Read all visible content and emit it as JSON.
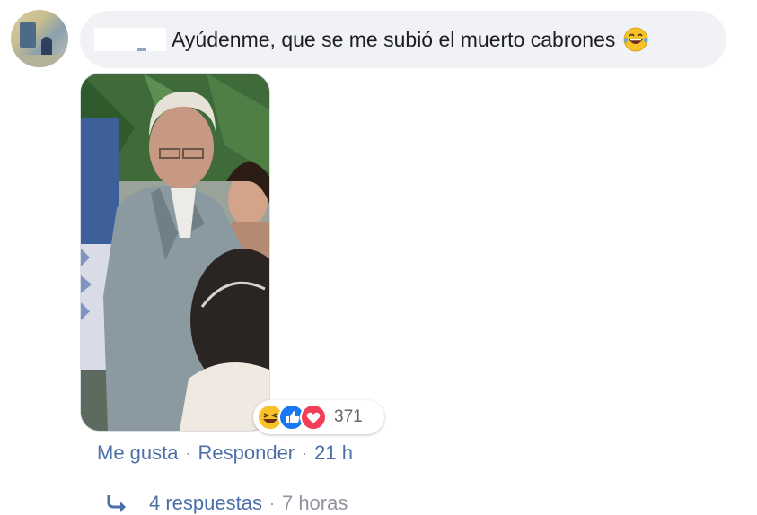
{
  "comment": {
    "text": "Ayúdenme, que se me subió el muerto cabrones",
    "emoji_icon": "laughing-tears-emoji"
  },
  "reactions": {
    "icons": [
      "haha-icon",
      "like-icon",
      "love-icon"
    ],
    "count": "371"
  },
  "actions": {
    "like_label": "Me gusta",
    "separator": "·",
    "reply_label": "Responder",
    "timestamp": "21 h"
  },
  "replies": {
    "label": "4 respuestas",
    "separator": "·",
    "timestamp": "7 horas"
  },
  "colors": {
    "bubble": "#f0f2f5",
    "link": "#4b6fa8",
    "like_blue": "#1877f2",
    "love_red": "#f33e58",
    "haha_yellow": "#f7b125"
  }
}
